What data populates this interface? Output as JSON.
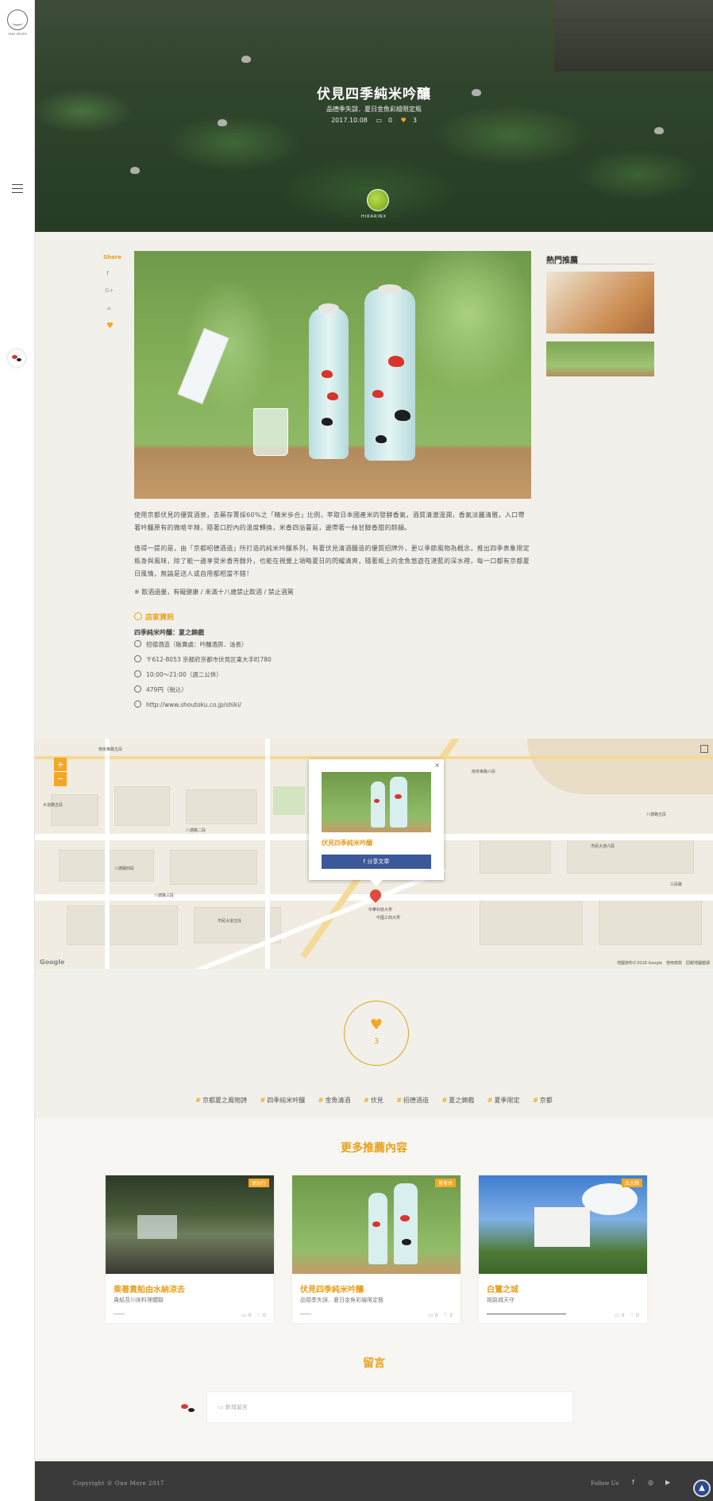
{
  "brand": {
    "logo_text": "one more"
  },
  "hero": {
    "title": "伏見四季純米吟釀",
    "subtitle": "品德季失誤．夏日金魚彩繪限定瓶",
    "date": "2017.10.08",
    "comments": "0",
    "likes": "3",
    "author": "HIKARINX"
  },
  "share": {
    "label": "Share",
    "icons": [
      "f",
      "G+",
      "∞",
      "♥"
    ]
  },
  "article": {
    "paragraphs": [
      "使用京都伏見的優質酒泉，去蕪存菁採60%之「精米歩合」比例，萃取日本國產米的發酵香氣，酒質清澈溫潤，香氣淡麗清雅，入口帶著吟釀原有的微嗆辛辣，隨著口腔內的溫度轉換，米香四溢蔓延，邊帶著一絲甘醇香甜的餘韻。",
      "值得一提的是，由「京都昭德酒造」所打造的純米吟釀系列，有著伏見清酒釀造的優質招牌外，更以季節風物為概念，推出四季表象限定瓶身與風味，除了能一邊享受米香芳醇外，也能在視覺上領略夏日的閃耀清爽，隨著瓶上的金魚悠遊在湛藍的深水裡，每一口都有京都夏日風情，無論是送人或自用都相當不錯！"
    ],
    "notice": "※ 飲酒過量，有礙健康 / 未滿十八歲禁止飲酒 / 禁止酒駕"
  },
  "store": {
    "title": "店家資訊",
    "name": "四季純米吟釀：夏之錦戲",
    "info": [
      "招德酒造（販賣處：吟釀酒房．油長）",
      "〒612-8053 京都府京都市伏見区東大手町780",
      "10:00～21:00（週二公休）",
      "479円（稅込）",
      "http://www.shoutoku.co.jp/shiki/"
    ]
  },
  "hot": {
    "title": "熱門推薦"
  },
  "map": {
    "popup_title": "伏見四季純米吟釀",
    "share_button": "f  分享文章",
    "close": "×",
    "zoom_in": "+",
    "zoom_out": "−",
    "credit": "地圖資料©2018 Google　使用條款　回報地圖錯誤",
    "google": "Google",
    "labels": [
      "南京東路五段",
      "八德路四段",
      "八德路三段",
      "市民大道六段",
      "南京東路六段",
      "八德路五段",
      "中華科技大學",
      "中國工商大學",
      "市民大道五段",
      "大道路五段",
      "三民路",
      "八德路二段"
    ]
  },
  "likes": {
    "count": "3"
  },
  "tags": [
    "京都夏之風物詩",
    "四季純米吟釀",
    "金魚清酒",
    "伏見",
    "招德酒造",
    "夏之錦戲",
    "夏季限定",
    "京都"
  ],
  "recommend": {
    "title": "更多推薦內容",
    "cards": [
      {
        "badge": "遊記行",
        "title": "乘著貴船由水納涼去",
        "subtitle": "貴船苔川床料理體驗",
        "comments": "0",
        "likes": "0"
      },
      {
        "badge": "嘗美食",
        "title": "伏見四季純米吟釀",
        "subtitle": "品德季失誤．夏日金魚彩繪限定瓶",
        "comments": "0",
        "likes": "3"
      },
      {
        "badge": "品古蹟",
        "title": "白鷺之城",
        "subtitle": "姬路城天守",
        "comments": "0",
        "likes": "0"
      }
    ]
  },
  "comment": {
    "title": "留言",
    "placeholder": "新增留言"
  },
  "footer": {
    "copyright": "Copyright © One More 2017",
    "follow": "Follow Us",
    "social": [
      "f",
      "◎",
      "▶"
    ],
    "top": "▲"
  },
  "colors": {
    "accent": "#f5a623",
    "facebook": "#3b5998",
    "footer": "#3a3a3a"
  }
}
